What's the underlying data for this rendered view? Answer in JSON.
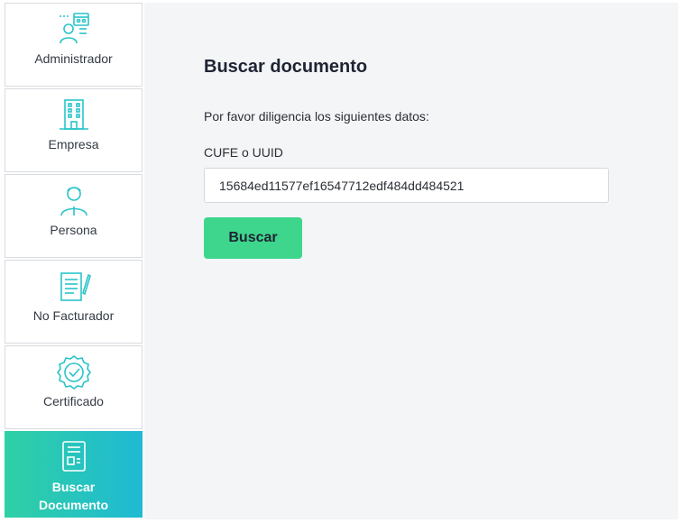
{
  "sidebar": {
    "items": [
      {
        "label": "Administrador",
        "icon": "admin-network-icon"
      },
      {
        "label": "Empresa",
        "icon": "building-icon"
      },
      {
        "label": "Persona",
        "icon": "person-icon"
      },
      {
        "label": "No Facturador",
        "icon": "document-pen-icon"
      },
      {
        "label": "Certificado",
        "icon": "certificate-badge-icon"
      },
      {
        "label_line1": "Buscar",
        "label_line2": "Documento",
        "icon": "document-search-icon",
        "active": true
      }
    ]
  },
  "main": {
    "title": "Buscar documento",
    "intro": "Por favor diligencia los siguientes datos:",
    "field_label": "CUFE o UUID",
    "field_value": "15684ed11577ef16547712edf484dd484521",
    "button_label": "Buscar"
  },
  "colors": {
    "accent_gradient_start": "#2fd0a4",
    "accent_gradient_end": "#1fb9d5",
    "button": "#3dd68c",
    "icon_teal": "#29c4c9"
  }
}
